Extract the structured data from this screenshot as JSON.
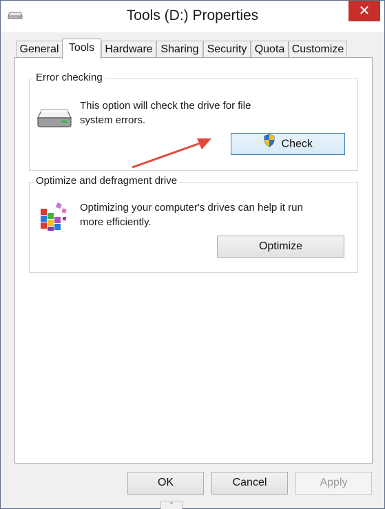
{
  "window": {
    "title": "Tools (D:) Properties",
    "close_label": "✕"
  },
  "tabs": [
    {
      "label": "General"
    },
    {
      "label": "Tools",
      "active": true
    },
    {
      "label": "Hardware"
    },
    {
      "label": "Sharing"
    },
    {
      "label": "Security"
    },
    {
      "label": "Quota"
    },
    {
      "label": "Customize"
    }
  ],
  "error_checking": {
    "title": "Error checking",
    "description_line1": "This option will check the drive for file",
    "description_line2": "system errors.",
    "check_label": "Check"
  },
  "optimize": {
    "title": "Optimize and defragment drive",
    "description_line1": "Optimizing your computer's drives can help it run",
    "description_line2": "more efficiently.",
    "optimize_label": "Optimize"
  },
  "footer": {
    "ok_label": "OK",
    "cancel_label": "Cancel",
    "apply_label": "Apply",
    "grip_glyph": "⌃"
  },
  "colors": {
    "close": "#c7302a",
    "annotation_arrow": "#e04a3c",
    "focus_border": "#3c7fb1"
  }
}
